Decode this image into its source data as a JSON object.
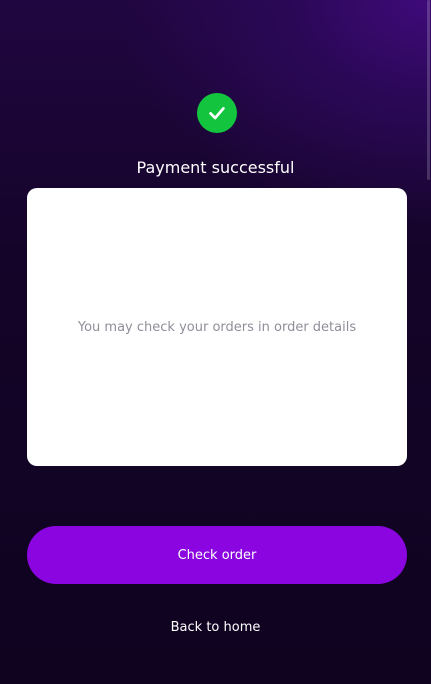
{
  "header": {
    "status_icon": "check-circle-icon",
    "title": "Payment successful"
  },
  "card": {
    "message": "You may check your orders in order details"
  },
  "actions": {
    "primary_label": "Check order",
    "secondary_label": "Back to home"
  },
  "colors": {
    "success": "#12c43e",
    "primary_button": "#8a05e0",
    "background_dark": "#0f0320",
    "background_accent": "#3f0a7a"
  }
}
